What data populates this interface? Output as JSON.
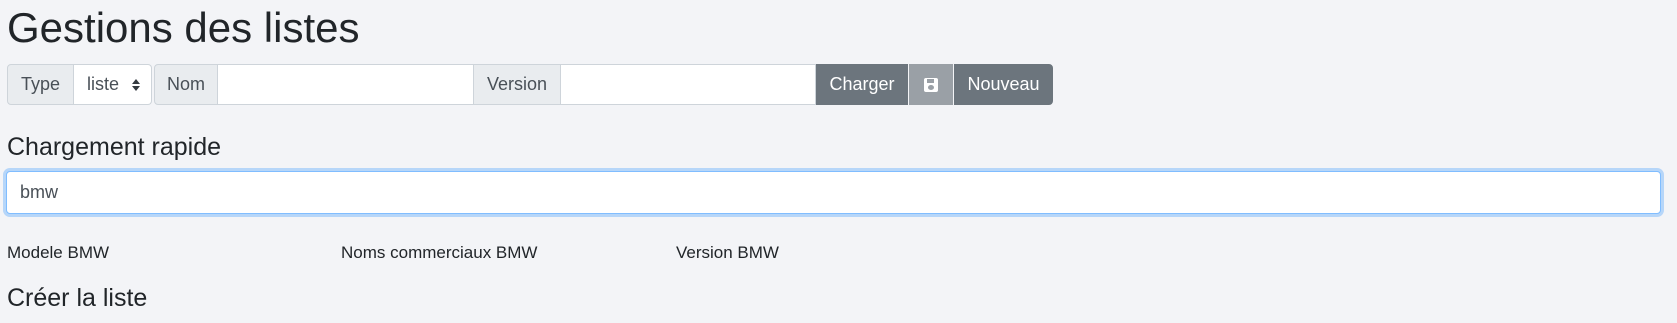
{
  "header": {
    "title": "Gestions des listes"
  },
  "toolbar": {
    "type_label": "Type",
    "type_value": "liste",
    "nom_label": "Nom",
    "nom_value": "",
    "version_label": "Version",
    "version_value": "",
    "charger_label": "Charger",
    "save_icon": "floppy-disk-icon",
    "nouveau_label": "Nouveau"
  },
  "quick_load": {
    "title": "Chargement rapide",
    "search_value": "bmw",
    "results": [
      "Modele BMW",
      "Noms commerciaux BMW",
      "Version BMW"
    ]
  },
  "create": {
    "title": "Créer la liste"
  },
  "colors": {
    "background": "#f3f4f7",
    "button": "#6c757d",
    "save_button": "#9aa0a6",
    "focus_border": "#80bdff"
  }
}
